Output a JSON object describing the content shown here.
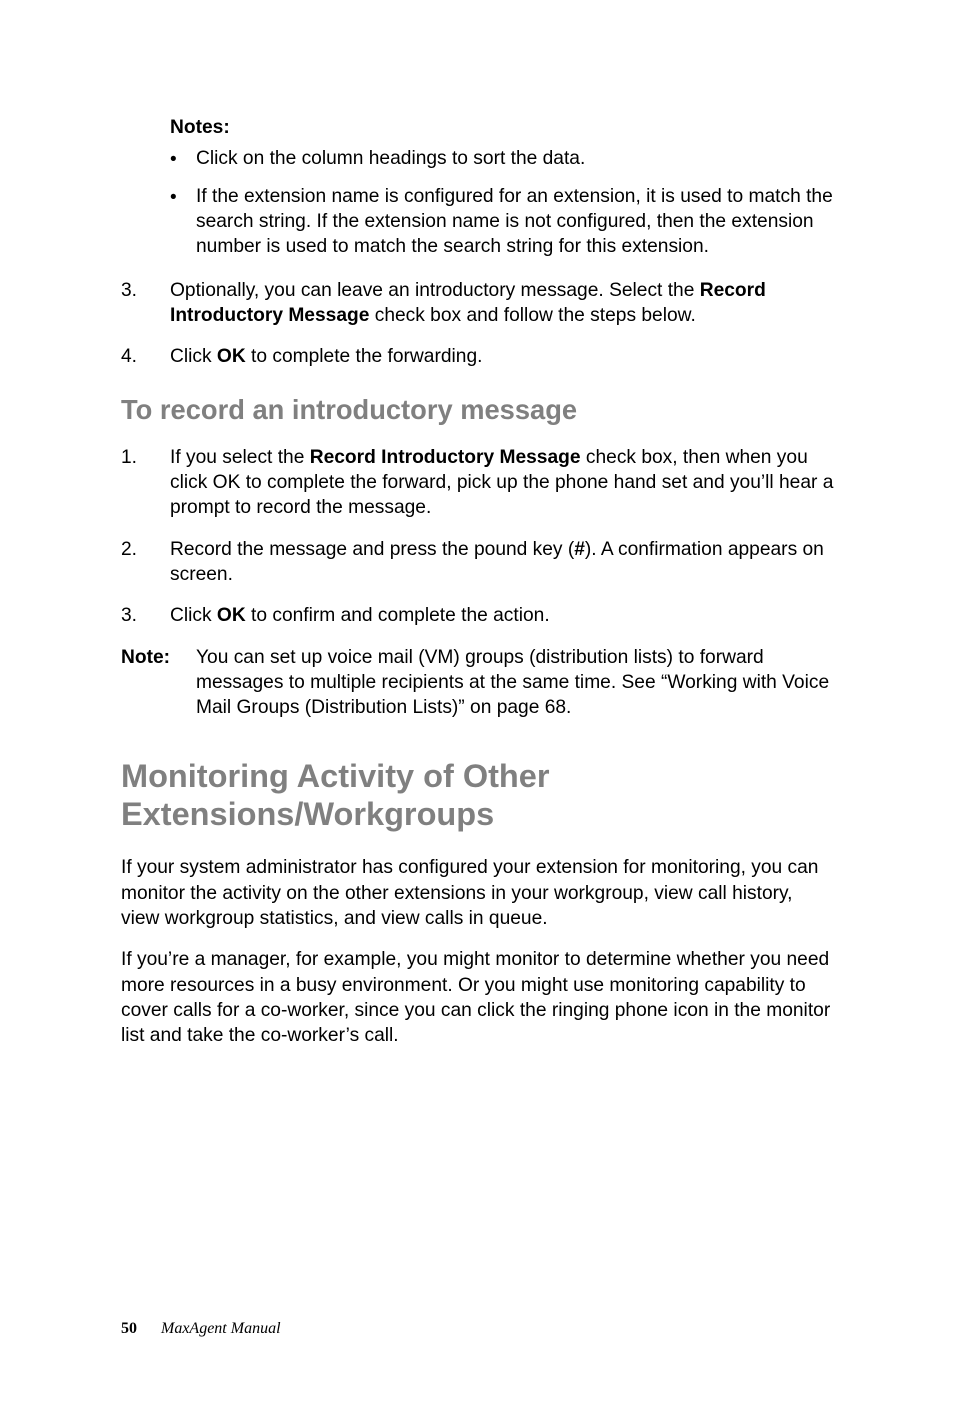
{
  "notes_label": "Notes",
  "colon": ":",
  "bullets": [
    "Click on the column headings to sort the data.",
    "If the extension name is configured for an extension, it is used to match the search string. If the extension name is not configured, then the extension number is used to match the search string for this extension."
  ],
  "step3": {
    "num": "3.",
    "pre": "Optionally, you can leave an introductory message. Select the ",
    "bold": "Record Introductory Message",
    "post": " check box and follow the steps below."
  },
  "step4": {
    "num": "4.",
    "pre": "Click ",
    "bold": "OK",
    "post": " to complete the forwarding."
  },
  "h2": "To record an introductory message",
  "recstep1": {
    "num": "1.",
    "pre": "If you select the ",
    "bold": "Record Introductory Message",
    "post": " check box, then when you click OK to complete the forward, pick up the phone hand set and you’ll hear a prompt to record the message."
  },
  "recstep2": {
    "num": "2.",
    "pre": "Record the message and press the pound key (",
    "bold": "#",
    "post": "). A confirmation appears on screen."
  },
  "recstep3": {
    "num": "3.",
    "pre": "Click ",
    "bold": "OK",
    "post": " to confirm and complete the action."
  },
  "note": {
    "label": "Note:",
    "text": "You can set up voice mail (VM) groups (distribution lists) to forward messages to multiple recipients at the same time. See “Working with Voice Mail Groups (Distribution Lists)” on page 68."
  },
  "h1": "Monitoring Activity of Other Extensions/Workgroups",
  "para1": "If your system administrator has configured your extension for monitoring, you can monitor the activity on the other extensions in your workgroup, view call history, view workgroup statistics, and view calls in queue.",
  "para2": "If you’re a manager, for example, you might monitor to determine whether you need more resources in a busy environment. Or you might use monitoring capability to cover calls for a co-worker, since you can click the ringing phone icon in the monitor list and take the co-worker’s call.",
  "footer": {
    "page": "50",
    "title": "MaxAgent Manual"
  }
}
